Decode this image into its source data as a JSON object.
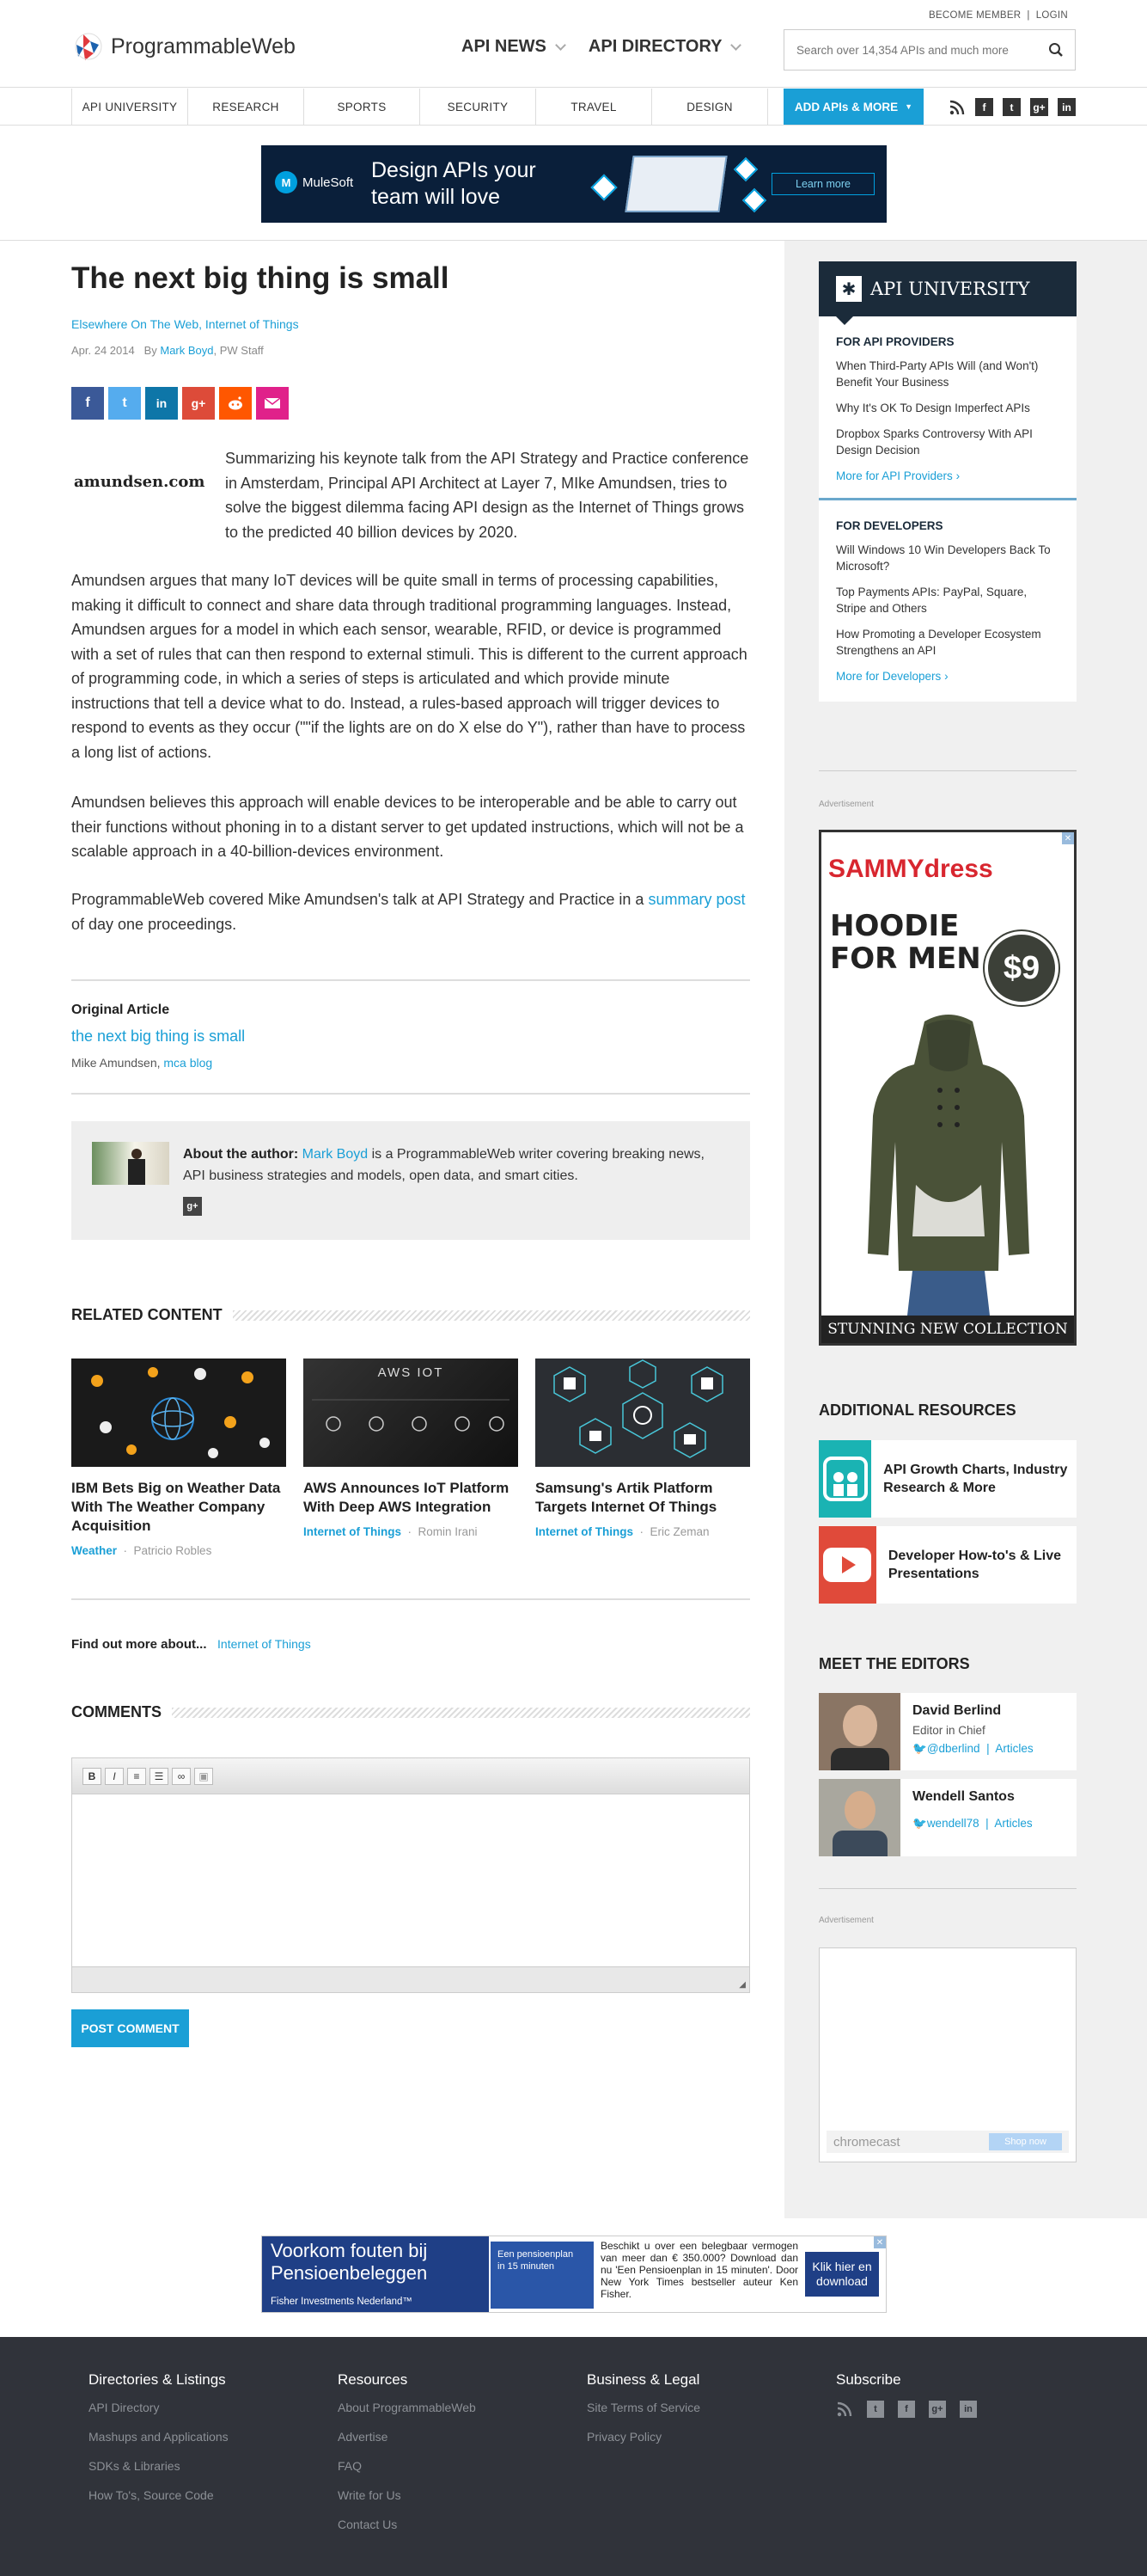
{
  "header": {
    "become_member": "BECOME MEMBER",
    "login": "LOGIN",
    "logo_text": "ProgrammableWeb",
    "nav": [
      "API NEWS",
      "API DIRECTORY"
    ],
    "search_placeholder": "Search over 14,354 APIs and much more",
    "subnav": [
      "API UNIVERSITY",
      "RESEARCH",
      "SPORTS",
      "SECURITY",
      "TRAVEL",
      "DESIGN"
    ],
    "add_button": "ADD APIs & MORE",
    "social_icons": [
      "rss-icon",
      "facebook-icon",
      "twitter-icon",
      "google-plus-icon",
      "linkedin-icon"
    ]
  },
  "top_ad": {
    "brand": "MuleSoft",
    "headline_1": "Design APIs your",
    "headline_2": "team will love",
    "cta": "Learn more"
  },
  "article": {
    "title": "The next big thing is small",
    "categories": "Elsewhere On The Web, Internet of Things",
    "date": "Apr. 24 2014",
    "by": "By",
    "author": "Mark Boyd",
    "author_suffix": ", PW Staff",
    "share_icons": [
      "facebook",
      "twitter",
      "linkedin",
      "google-plus",
      "reddit",
      "email"
    ],
    "source_logo": "amundsen.com",
    "lead": "Summarizing his keynote talk from the API Strategy and Practice conference in Amsterdam, Principal API Architect at Layer 7, MIke Amundsen, tries to solve the biggest dilemma facing API design as the Internet of Things grows to the predicted 40 billion devices by 2020.",
    "p2": "Amundsen argues that many IoT devices will be quite small in terms of processing capabilities, making it difficult to connect and share data through traditional programming languages. Instead, Amundsen argues for a model in which each sensor, wearable, RFID, or device is programmed with a set of rules that can then respond to external stimuli. This is different to the current approach of programming code, in which a series of steps is articulated and which provide minute instructions that tell a device what to do. Instead, a rules-based approach will trigger devices to respond to events as they occur (\"\"if the lights are on do X else do Y\"), rather than have to process a long list of actions.",
    "p3": "Amundsen believes this approach will enable devices to be interoperable and be able to carry out their functions without phoning in to a distant server to get updated instructions, which will not be a scalable approach in a 40-billion-devices environment.",
    "p4_pre": "ProgrammableWeb covered Mike Amundsen's talk at API Strategy and Practice in a",
    "p4_link": "summary post",
    "p4_post": "of day one proceedings.",
    "original_heading": "Original Article",
    "original_title": "the next big thing is small",
    "original_author": "Mike Amundsen,",
    "original_source": "mca blog",
    "about_label": "About the author:",
    "about_name": "Mark Boyd",
    "about_text": "is a ProgrammableWeb writer covering breaking news, API business strategies and models, open data, and smart cities."
  },
  "related": {
    "heading": "RELATED CONTENT",
    "items": [
      {
        "title": "IBM Bets Big on Weather Data With The Weather Company Acquisition",
        "tag": "Weather",
        "author": "Patricio Robles"
      },
      {
        "title": "AWS Announces IoT Platform With Deep AWS Integration",
        "tag": "Internet of Things",
        "author": "Romin Irani",
        "image_text": "AWS IOT"
      },
      {
        "title": "Samsung's Artik Platform Targets Internet Of Things",
        "tag": "Internet of Things",
        "author": "Eric Zeman"
      }
    ]
  },
  "find_more": {
    "label": "Find out more about...",
    "link": "Internet of Things"
  },
  "comments": {
    "heading": "COMMENTS",
    "toolbar": [
      "B",
      "I",
      "ol",
      "ul",
      "link",
      "img"
    ],
    "post_button": "POST COMMENT"
  },
  "sidebar": {
    "api_university": "API UNIVERSITY",
    "providers_heading": "FOR API PROVIDERS",
    "providers": [
      "When Third-Party APIs Will (and Won't) Benefit Your Business",
      "Why It's OK To Design Imperfect APIs",
      "Dropbox Sparks Controversy With API Design Decision"
    ],
    "providers_more": "More for API Providers",
    "developers_heading": "FOR DEVELOPERS",
    "developers": [
      "Will Windows 10 Win Developers Back To Microsoft?",
      "Top Payments APIs: PayPal, Square, Stripe and Others",
      "How Promoting a Developer Ecosystem Strengthens an API"
    ],
    "developers_more": "More for Developers",
    "ad_label": "Advertisement",
    "side_ad": {
      "brand": "SAMMYdress",
      "line1": "HOODIE",
      "line2": "FOR MEN",
      "price": "$9",
      "footer": "STUNNING NEW COLLECTION"
    },
    "resources_heading": "ADDITIONAL RESOURCES",
    "resources": [
      "API Growth Charts, Industry Research & More",
      "Developer How-to's & Live Presentations"
    ],
    "editors_heading": "MEET THE EDITORS",
    "editors": [
      {
        "name": "David Berlind",
        "role": "Editor in Chief",
        "handle": "@dberlind",
        "articles": "Articles"
      },
      {
        "name": "Wendell Santos",
        "handle": "wendell78",
        "articles": "Articles"
      }
    ],
    "ad2_brand": "chromecast",
    "ad2_cta": "Shop now"
  },
  "bottom_ad": {
    "line1": "Voorkom fouten bij",
    "line2": "Pensioenbeleggen",
    "brand": "Fisher Investments Nederland™",
    "book_1": "Een pensioenplan",
    "book_2": "in 15 minuten",
    "text": "Beschikt u over een belegbaar vermogen van meer dan € 350.000? Download dan nu 'Een Pensioenplan in 15 minuten'. Door New York Times bestseller auteur Ken Fisher.",
    "cta": "Klik hier en download"
  },
  "footer": {
    "cols": [
      {
        "heading": "Directories & Listings",
        "links": [
          "API Directory",
          "Mashups and Applications",
          "SDKs & Libraries",
          "How To's, Source Code"
        ]
      },
      {
        "heading": "Resources",
        "links": [
          "About ProgrammableWeb",
          "Advertise",
          "FAQ",
          "Write for Us",
          "Contact Us"
        ]
      },
      {
        "heading": "Business & Legal",
        "links": [
          "Site Terms of Service",
          "Privacy Policy"
        ]
      },
      {
        "heading": "Subscribe",
        "links": []
      }
    ]
  },
  "colors": {
    "accent": "#1a9fd6",
    "dark_navy": "#1b2b3a",
    "footer_bg": "#30333a"
  }
}
